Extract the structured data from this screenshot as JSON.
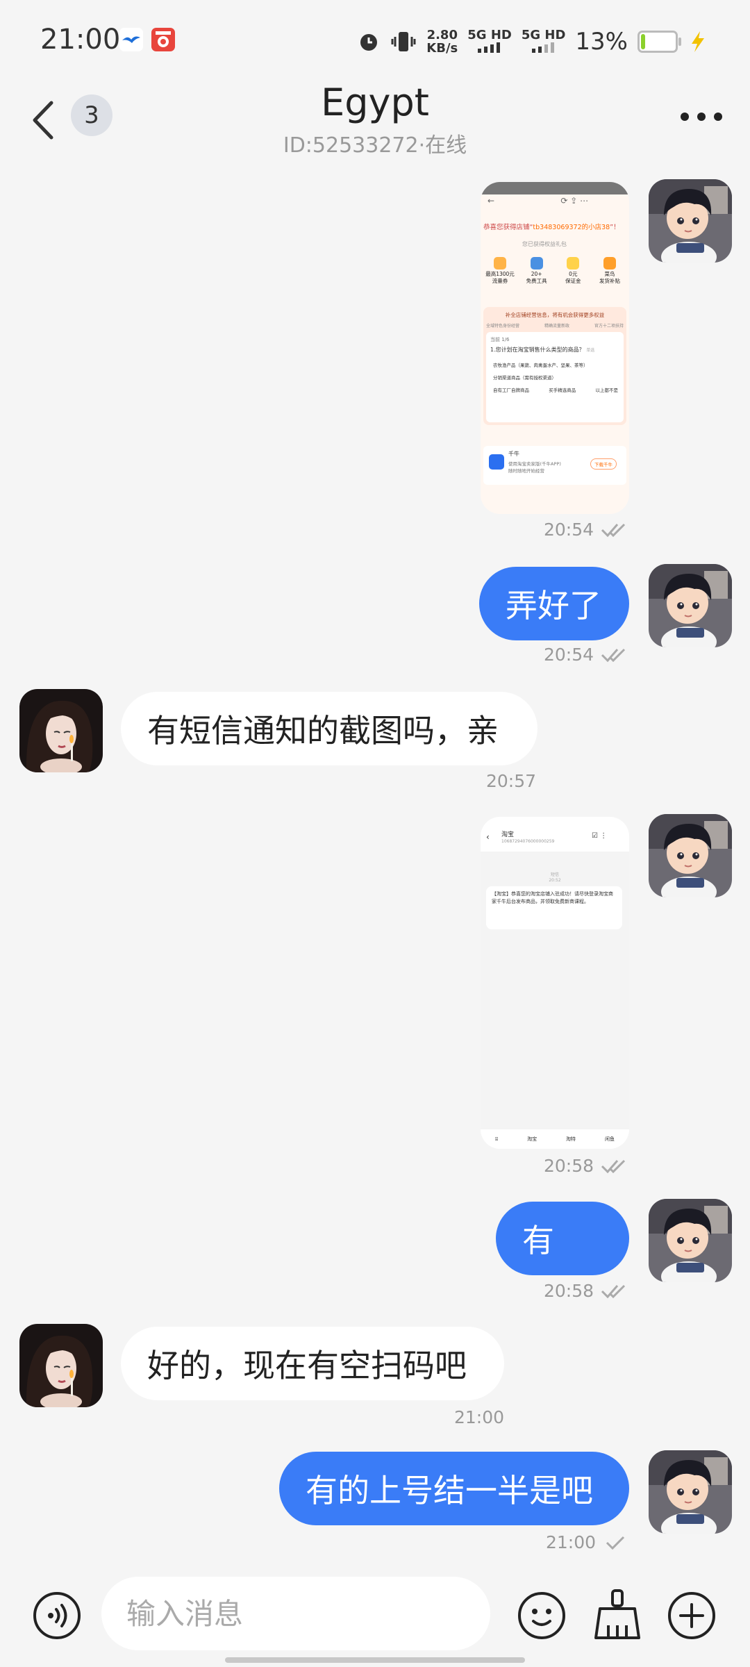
{
  "status_bar": {
    "time": "21:00",
    "net_speed_value": "2.80",
    "net_speed_unit": "KB/s",
    "sim1": "5G HD",
    "sim2": "5G HD",
    "battery_percent": "13%",
    "battery_level": 0.13,
    "icons": [
      "bird-app-icon",
      "red-app-icon",
      "alarm-icon",
      "vibrate-icon",
      "signal-icon",
      "battery-icon",
      "charging-icon"
    ]
  },
  "header": {
    "unread_count": "3",
    "title": "Egypt",
    "subtitle": "ID:52533272·在线"
  },
  "messages": [
    {
      "side": "mine",
      "type": "image",
      "time": "20:54",
      "status": "read",
      "preview": {
        "title_prefix": "恭喜您获得店铺“",
        "title_highlight": "tb3483069372的小店38",
        "title_suffix": "”！",
        "gift_text": "您已获得权益礼包",
        "benefits": [
          {
            "line1": "最高1300元",
            "line2": "流量券"
          },
          {
            "line1": "20+",
            "line2": "免费工具"
          },
          {
            "line1": "0元",
            "line2": "保证金"
          },
          {
            "line1": "菜鸟",
            "line2": "发货补贴"
          }
        ],
        "promo": "补全店铺经营信息，将有机会获得更多权益",
        "links": [
          "全域特色身份经营",
          "精确流量新政",
          "官方十二项扶持"
        ],
        "progress": "当前 1/6",
        "question": "1.您计划在淘宝销售什么类型的商品？",
        "question_tag": "单选",
        "options": [
          "农牧渔产品（果蔬、肉禽蛋水产、坚果、茶等）",
          "分销渠道商品（需有授权渠道）",
          "自有工厂自牌商品",
          "买手精选商品",
          "以上都不是"
        ],
        "app_name": "千牛",
        "app_desc_1": "使用淘宝卖家版(千牛APP)",
        "app_desc_2": "随时随地开始经营",
        "download_label": "下载千牛"
      }
    },
    {
      "side": "mine",
      "type": "text",
      "text": "弄好了",
      "time": "20:54",
      "status": "read"
    },
    {
      "side": "theirs",
      "type": "text",
      "text": "有短信通知的截图吗，亲",
      "time": "20:57"
    },
    {
      "side": "mine",
      "type": "image",
      "time": "20:58",
      "status": "read",
      "preview": {
        "contact": "淘宝",
        "number": "10687294076000000259",
        "date_label": "短信",
        "time_label": "20:52",
        "sms": "【淘宝】恭喜您的淘宝店铺入驻成功！请尽快登录淘宝商家千牛后台发布商品，并领取免费新商课程。",
        "tabs": [
          "淘宝",
          "淘特",
          "闲鱼"
        ]
      }
    },
    {
      "side": "mine",
      "type": "text",
      "text": "有",
      "time": "20:58",
      "status": "read"
    },
    {
      "side": "theirs",
      "type": "text",
      "text": "好的，现在有空扫码吧",
      "time": "21:00"
    },
    {
      "side": "mine",
      "type": "text",
      "text": "有的上号结一半是吧",
      "time": "21:00",
      "status": "sent"
    }
  ],
  "input_bar": {
    "placeholder": "输入消息",
    "icons": [
      "voice-icon",
      "emoji-icon",
      "broom-icon",
      "plus-icon"
    ]
  },
  "colors": {
    "accent": "#3a7cf7",
    "background": "#f5f5f5",
    "bubble_theirs": "#ffffff",
    "highlight": "#ff6a00"
  }
}
